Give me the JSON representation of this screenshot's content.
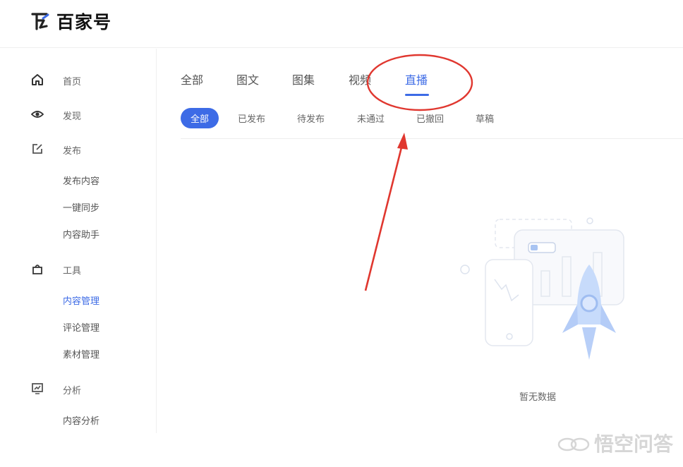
{
  "brand": {
    "name": "百家号"
  },
  "sidebar": {
    "items": [
      {
        "key": "home",
        "label": "首页",
        "icon": "home-icon"
      },
      {
        "key": "discover",
        "label": "发现",
        "icon": "eye-icon"
      },
      {
        "key": "publish",
        "label": "发布",
        "icon": "edit-icon"
      },
      {
        "key": "tools",
        "label": "工具",
        "icon": "bag-icon"
      },
      {
        "key": "analytics",
        "label": "分析",
        "icon": "chart-icon"
      }
    ],
    "publish_sub": [
      "发布内容",
      "一键同步",
      "内容助手"
    ],
    "tools_sub": [
      "内容管理",
      "评论管理",
      "素材管理"
    ],
    "analytics_sub": [
      "内容分析"
    ],
    "active_sub": "内容管理"
  },
  "tabs": [
    "全部",
    "图文",
    "图集",
    "视频",
    "直播"
  ],
  "active_tab": "直播",
  "chips": [
    "全部",
    "已发布",
    "待发布",
    "未通过",
    "已撤回",
    "草稿"
  ],
  "active_chip": "全部",
  "empty_state": {
    "text": "暂无数据"
  },
  "watermark": {
    "text": "悟空问答"
  },
  "colors": {
    "accent": "#3d6be6",
    "annotation": "#e0372f"
  }
}
